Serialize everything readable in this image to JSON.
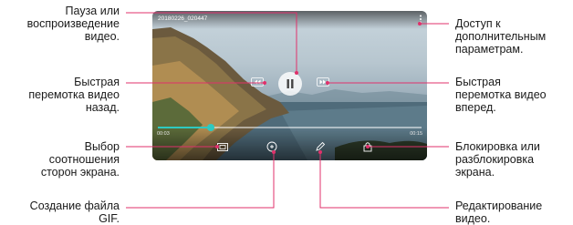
{
  "labels": {
    "pause_play": "Пауза или\nвоспроизведение\nвидео.",
    "rewind": "Быстрая\nперемотка видео\nназад.",
    "aspect_ratio": "Выбор\nсоотношения\nсторон экрана.",
    "create_gif": "Создание файла\nGIF.",
    "more_options": "Доступ к\nдополнительным\nпараметрам.",
    "forward": "Быстрая\nперемотка видео\nвперед.",
    "lock": "Блокировка или\nразблокировка\nэкрана.",
    "edit": "Редактирование\nвидео."
  },
  "player": {
    "filename": "20180226_020447",
    "time_current": "00:03",
    "time_total": "00:15",
    "progress": 0.2
  },
  "icons": {
    "pause": "pause-icon",
    "rewind": "rewind-icon",
    "forward": "fast-forward-icon",
    "more": "more-vertical-icon",
    "ratio": "aspect-ratio-icon",
    "gif": "gif-icon",
    "edit": "pencil-icon",
    "lock": "lock-icon"
  },
  "colors": {
    "accent": "#2ec9c1",
    "callout_line": "#e0316b"
  }
}
